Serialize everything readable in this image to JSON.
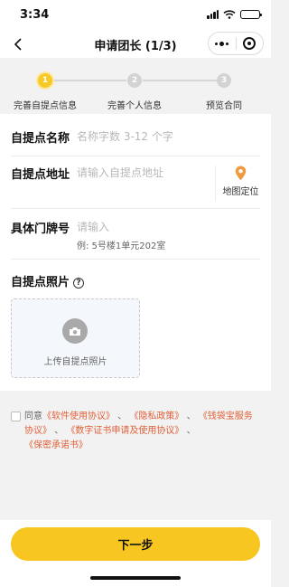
{
  "status_bar": {
    "time": "3:34"
  },
  "nav": {
    "title": "申请团长 (1/3)"
  },
  "steps": [
    {
      "number": "1",
      "label": "完善自提点信息",
      "active": true
    },
    {
      "number": "2",
      "label": "完善个人信息",
      "active": false
    },
    {
      "number": "3",
      "label": "预览合同",
      "active": false
    }
  ],
  "form": {
    "name": {
      "label": "自提点名称",
      "placeholder": "名称字数 3-12 个字"
    },
    "address": {
      "label": "自提点地址",
      "placeholder": "请输入自提点地址",
      "map_button": "地图定位"
    },
    "door": {
      "label": "具体门牌号",
      "placeholder": "请输入",
      "example": "例: 5号楼1单元202室"
    },
    "photo": {
      "label": "自提点照片",
      "help_icon": "?",
      "upload_label": "上传自提点照片"
    }
  },
  "agreement": {
    "prefix": "同意",
    "links": [
      "《软件使用协议》",
      "《隐私政策》",
      "《钱袋宝服务协议》",
      "《数字证书申请及使用协议》",
      "《保密承诺书》"
    ],
    "separator": "、"
  },
  "next_button": "下一步",
  "colors": {
    "accent": "#f7c620",
    "link": "#e0613a",
    "pin": "#f09a3e"
  }
}
